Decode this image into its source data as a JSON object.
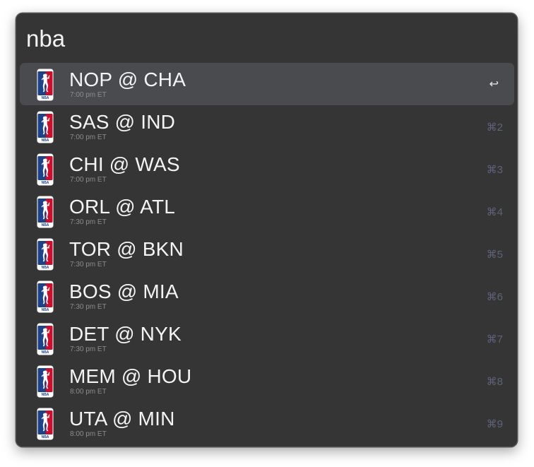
{
  "search": {
    "value": "nba"
  },
  "colors": {
    "logo_blue": "#1d428a",
    "logo_red": "#c8102e"
  },
  "results": [
    {
      "title": "NOP @ CHA",
      "subtitle": "7:00 pm ET",
      "shortcut": "↩",
      "selected": true
    },
    {
      "title": "SAS @ IND",
      "subtitle": "7:00 pm ET",
      "shortcut": "⌘2"
    },
    {
      "title": "CHI @ WAS",
      "subtitle": "7:00 pm ET",
      "shortcut": "⌘3"
    },
    {
      "title": "ORL @ ATL",
      "subtitle": "7:30 pm ET",
      "shortcut": "⌘4"
    },
    {
      "title": "TOR @ BKN",
      "subtitle": "7:30 pm ET",
      "shortcut": "⌘5"
    },
    {
      "title": "BOS @ MIA",
      "subtitle": "7:30 pm ET",
      "shortcut": "⌘6"
    },
    {
      "title": "DET @ NYK",
      "subtitle": "7:30 pm ET",
      "shortcut": "⌘7"
    },
    {
      "title": "MEM @ HOU",
      "subtitle": "8:00 pm ET",
      "shortcut": "⌘8"
    },
    {
      "title": "UTA @ MIN",
      "subtitle": "8:00 pm ET",
      "shortcut": "⌘9"
    }
  ],
  "logo": {
    "icon": "nba-logo-icon",
    "text": "NBA"
  }
}
